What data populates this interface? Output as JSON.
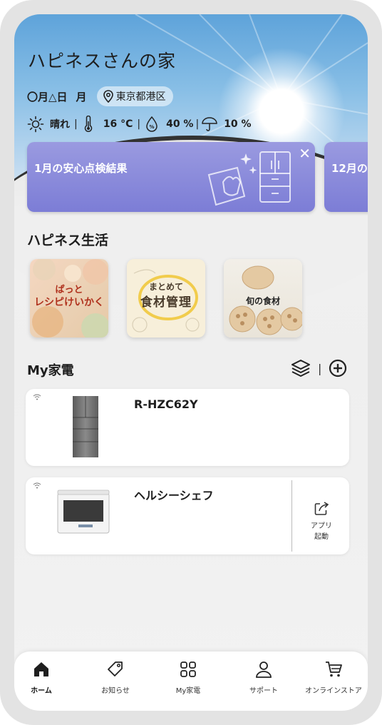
{
  "header": {
    "home_title": "ハピネスさんの家",
    "date": "〇月△日",
    "weekday": "月",
    "location": "東京都港区"
  },
  "weather": {
    "condition": "晴れ",
    "temperature": "16 °C",
    "humidity": "40 %",
    "precipitation": "10 %"
  },
  "banners": [
    {
      "label": "1月の安心点検結果"
    },
    {
      "label": "12月の"
    }
  ],
  "happiness": {
    "title": "ハピネス生活",
    "tiles": [
      {
        "line1": "ぱっと",
        "line2": "レシピけいかく"
      },
      {
        "line1": "まとめて",
        "line2": "食材管理"
      },
      {
        "line1": "旬の食材"
      }
    ]
  },
  "my_appliances": {
    "title": "My家電",
    "items": [
      {
        "name": "R-HZC62Y"
      },
      {
        "name": "ヘルシーシェフ",
        "app_launch": "アプリ\n起動",
        "app_launch_l1": "アプリ",
        "app_launch_l2": "起動"
      }
    ]
  },
  "nav": [
    {
      "label": "ホーム",
      "icon": "home-icon",
      "active": true
    },
    {
      "label": "お知らせ",
      "icon": "tag-icon"
    },
    {
      "label": "My家電",
      "icon": "grid-icon"
    },
    {
      "label": "サポート",
      "icon": "person-icon"
    },
    {
      "label": "オンラインストア",
      "icon": "cart-icon"
    }
  ],
  "colors": {
    "banner": "#8a8bdb",
    "sky": "#6aaae0",
    "text": "#1e1e1e"
  }
}
